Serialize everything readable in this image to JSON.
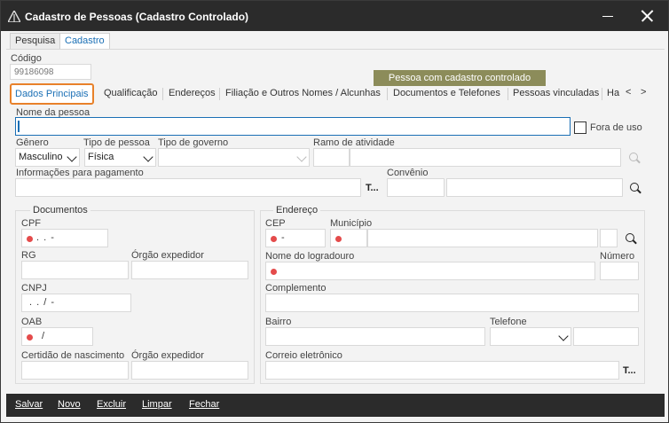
{
  "window": {
    "title": "Cadastro de Pessoas (Cadastro Controlado)"
  },
  "top_tabs": [
    "Pesquisa",
    "Cadastro"
  ],
  "codigo": {
    "label": "Código",
    "value": "99186098"
  },
  "badge": "Pessoa com cadastro controlado",
  "subtabs": [
    "Dados Principais",
    "Qualificação",
    "Endereços",
    "Filiação e Outros Nomes / Alcunhas",
    "Documentos e Telefones",
    "Pessoas vinculadas",
    "Ha"
  ],
  "subtab_nav": {
    "prev": "<",
    "next": ">"
  },
  "form": {
    "nome_label": "Nome da pessoa",
    "fora_de_uso": "Fora de uso",
    "genero_label": "Gênero",
    "genero_value": "Masculino",
    "tipo_pessoa_label": "Tipo de pessoa",
    "tipo_pessoa_value": "Física",
    "tipo_governo_label": "Tipo de governo",
    "ramo_label": "Ramo de atividade",
    "info_pag_label": "Informações para pagamento",
    "info_pag_btn": "T...",
    "convenio_label": "Convênio"
  },
  "documentos": {
    "title": "Documentos",
    "cpf_label": "CPF",
    "cpf_mask": ".  .  -",
    "rg_label": "RG",
    "orgao_label": "Órgão expedidor",
    "cnpj_label": "CNPJ",
    "cnpj_mask": ".  .  /  -",
    "oab_label": "OAB",
    "oab_mask": "/",
    "certidao_label": "Certidão de nascimento",
    "orgao2_label": "Órgão expedidor"
  },
  "endereco": {
    "title": "Endereço",
    "cep_label": "CEP",
    "cep_mask": "-",
    "municipio_label": "Município",
    "logradouro_label": "Nome do logradouro",
    "numero_label": "Número",
    "complemento_label": "Complemento",
    "bairro_label": "Bairro",
    "telefone_label": "Telefone",
    "email_label": "Correio eletrônico",
    "email_btn": "T..."
  },
  "bottom_buttons": [
    "Salvar",
    "Novo",
    "Excluir",
    "Limpar",
    "Fechar"
  ],
  "colors": {
    "accent": "#1a6fb5",
    "highlight": "#e8812a",
    "badge": "#8c8c5a",
    "required": "#e44b4b",
    "titlebar": "#2b2b2b"
  }
}
